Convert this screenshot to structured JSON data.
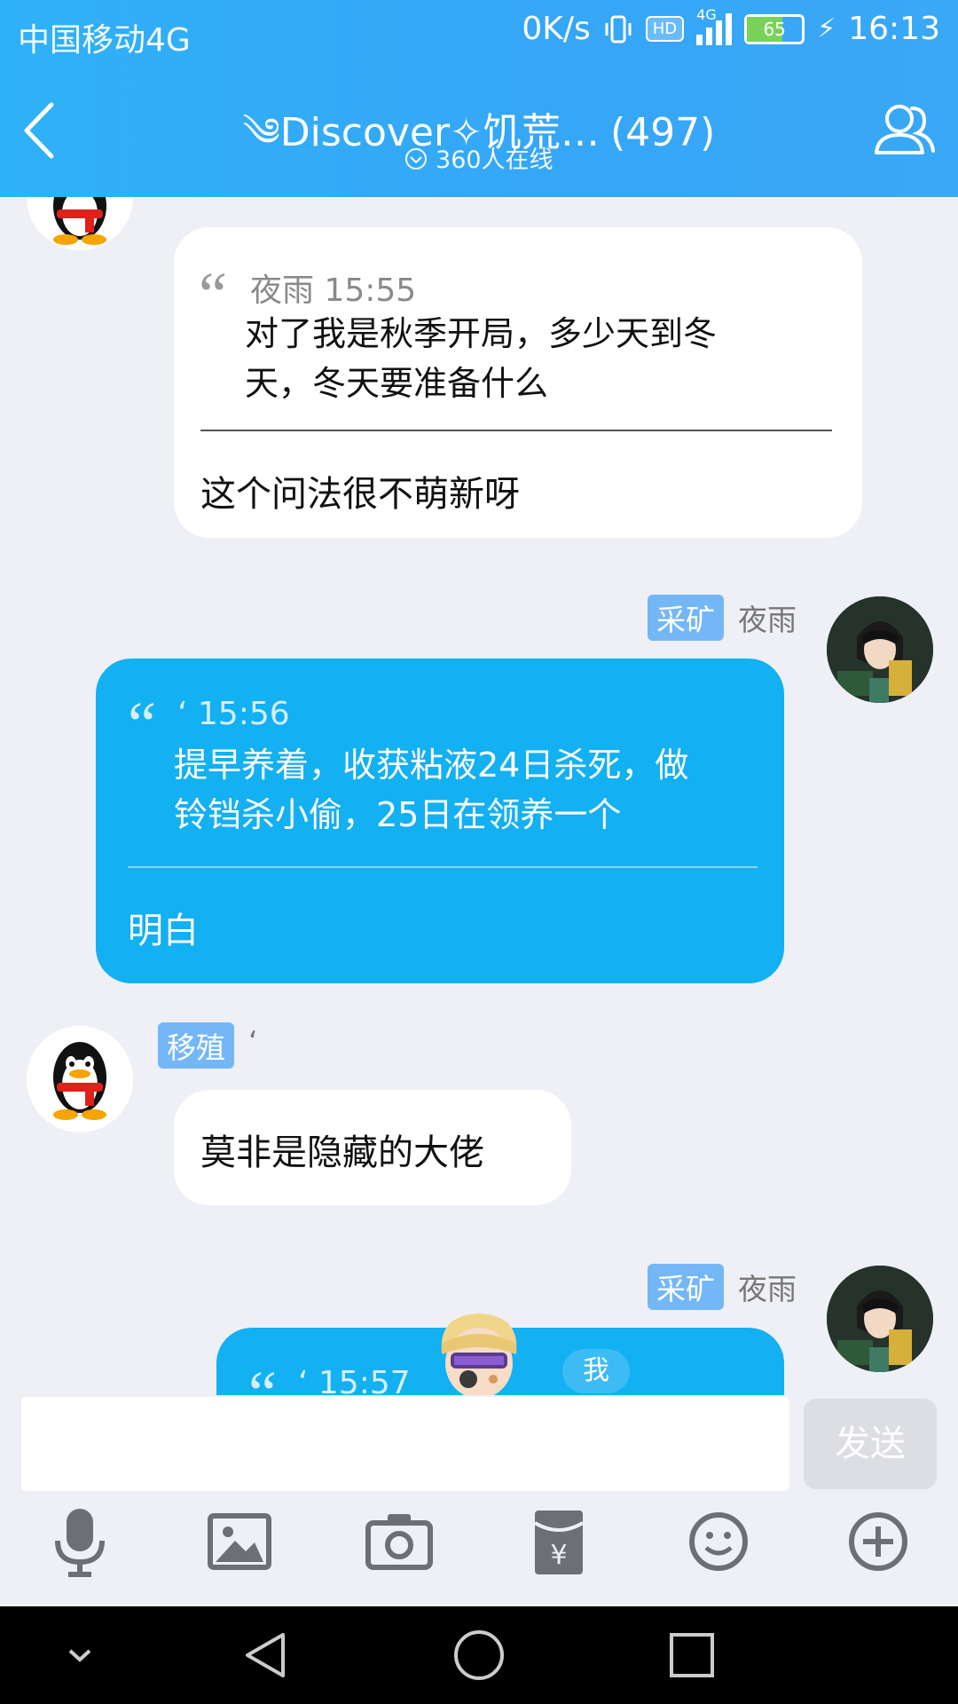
{
  "status_bar": {
    "carrier": "中国移动4G",
    "speed": "0K/s",
    "hd": "HD",
    "network": "4G",
    "battery": "65",
    "time": "16:13"
  },
  "header": {
    "title": "༄Discover✧饥荒…",
    "member_count": "(497)",
    "online": "360人在线"
  },
  "messages": [
    {
      "quote_author": "夜雨 15:55",
      "quote_text_line1": "对了我是秋季开局，多少天到冬",
      "quote_text_line2": "天，冬天要准备什么",
      "reply": "这个问法很不萌新呀"
    },
    {
      "tag": "采矿",
      "sender": "夜雨",
      "quote_author": "‘ 15:56",
      "quote_text_line1": "提早养着，收获粘液24日杀死，做",
      "quote_text_line2": "铃铛杀小偷，25日在领养一个",
      "reply": "明白"
    },
    {
      "tag": "移殖",
      "sender": "‘",
      "text": "莫非是隐藏的大佬"
    },
    {
      "tag": "采矿",
      "sender": "夜雨",
      "quote_author": "‘ 15:57",
      "sticker_text": "我"
    }
  ],
  "input": {
    "send_label": "发送"
  },
  "colors": {
    "header": "#36a6f7",
    "bubble_blue": "#13b0f2",
    "tag": "#73b7f7"
  }
}
